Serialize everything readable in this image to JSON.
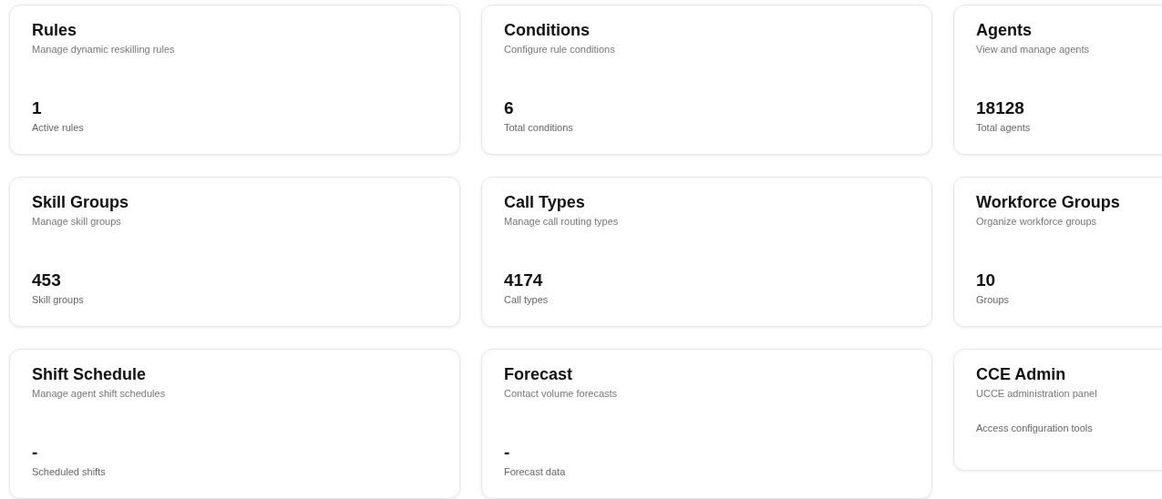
{
  "cards": [
    {
      "kind": "stat",
      "title": "Rules",
      "subtitle": "Manage dynamic reskilling rules",
      "value": "1",
      "caption": "Active rules"
    },
    {
      "kind": "stat",
      "title": "Conditions",
      "subtitle": "Configure rule conditions",
      "value": "6",
      "caption": "Total conditions"
    },
    {
      "kind": "stat",
      "title": "Agents",
      "subtitle": "View and manage agents",
      "value": "18128",
      "caption": "Total agents"
    },
    {
      "kind": "stat",
      "title": "Skill Groups",
      "subtitle": "Manage skill groups",
      "value": "453",
      "caption": "Skill groups"
    },
    {
      "kind": "stat",
      "title": "Call Types",
      "subtitle": "Manage call routing types",
      "value": "4174",
      "caption": "Call types"
    },
    {
      "kind": "stat",
      "title": "Workforce Groups",
      "subtitle": "Organize workforce groups",
      "value": "10",
      "caption": "Groups"
    },
    {
      "kind": "stat",
      "title": "Shift Schedule",
      "subtitle": "Manage agent shift schedules",
      "value": "-",
      "caption": "Scheduled shifts"
    },
    {
      "kind": "stat",
      "title": "Forecast",
      "subtitle": "Contact volume forecasts",
      "value": "-",
      "caption": "Forecast data"
    },
    {
      "kind": "link",
      "title": "CCE Admin",
      "subtitle": "UCCE administration panel",
      "caption": "Access configuration tools"
    }
  ]
}
